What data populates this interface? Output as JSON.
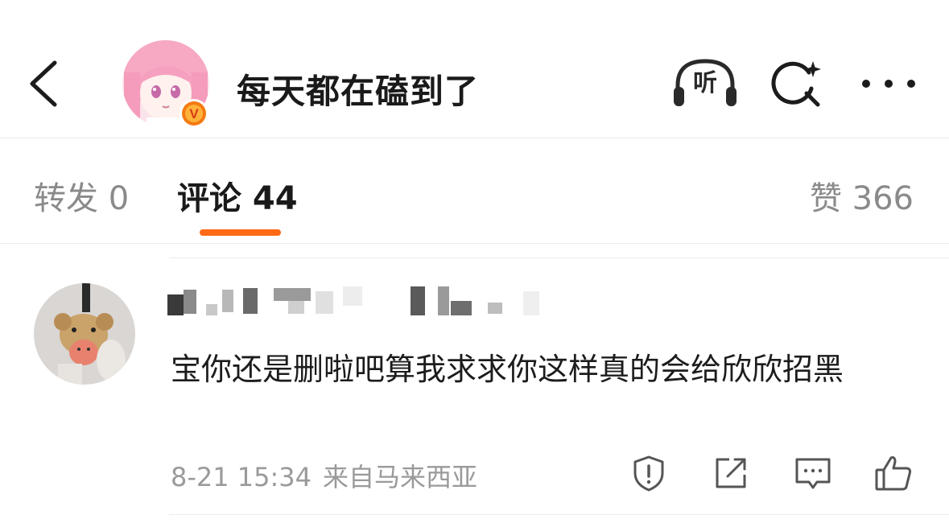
{
  "header": {
    "back_icon": "chevron-left-icon",
    "username": "每天都在磕到了",
    "verified_badge": "V",
    "listen_label": "听",
    "search_icon": "search-sparkle-icon",
    "more_icon": "more-horizontal-icon"
  },
  "tabs": {
    "repost": "转发 0",
    "comment": "评论 44",
    "like": "赞 366",
    "active_color": "#ff6a16"
  },
  "comment": {
    "text": "宝你还是删啦吧算我求求你这样真的会给欣欣招黑",
    "time": "8-21 15:34",
    "source": "来自马来西亚",
    "actions": [
      "report-icon",
      "share-icon",
      "reply-icon",
      "like-icon"
    ]
  }
}
